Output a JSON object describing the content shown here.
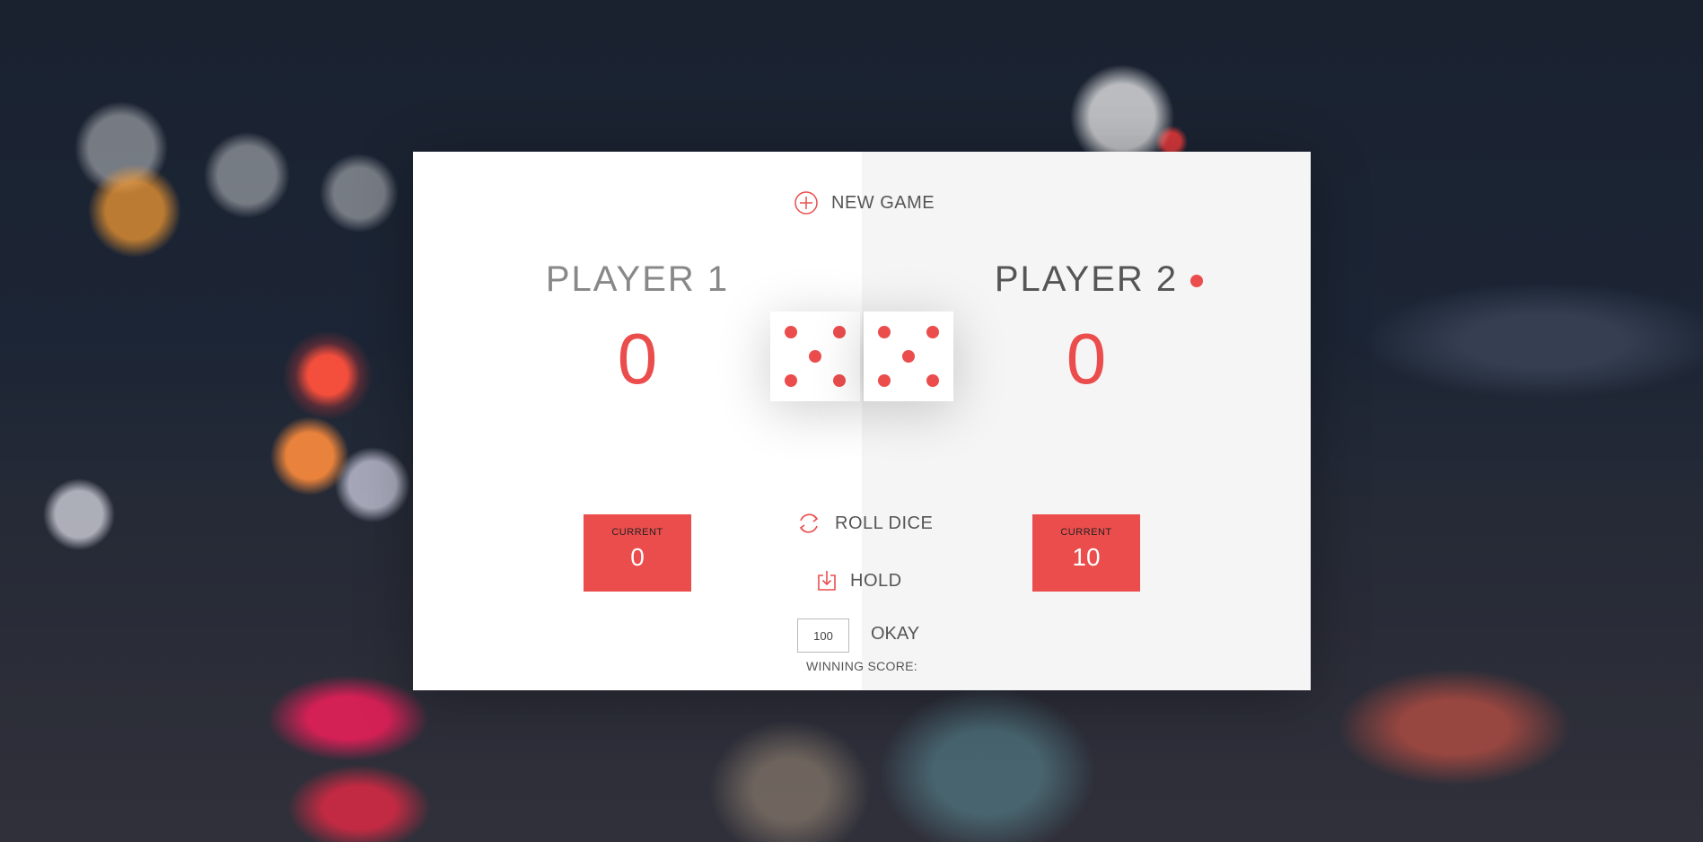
{
  "game": {
    "new_game_label": "NEW GAME",
    "roll_dice_label": "ROLL DICE",
    "hold_label": "HOLD",
    "okay_label": "OKAY",
    "winning_score_label": "WINNING SCORE:",
    "winning_score_value": "100",
    "active_player": 2,
    "accent_color": "#eb4d4d"
  },
  "players": [
    {
      "name": "PLAYER 1",
      "score": "0",
      "current_label": "CURRENT",
      "current": "0",
      "active": false
    },
    {
      "name": "PLAYER 2",
      "score": "0",
      "current_label": "CURRENT",
      "current": "10",
      "active": true
    }
  ],
  "dice": [
    5,
    5
  ],
  "icons": {
    "new_game": "plus-circle-icon",
    "roll_dice": "refresh-icon",
    "hold": "download-icon",
    "active_player": "active-player-dot-icon"
  }
}
